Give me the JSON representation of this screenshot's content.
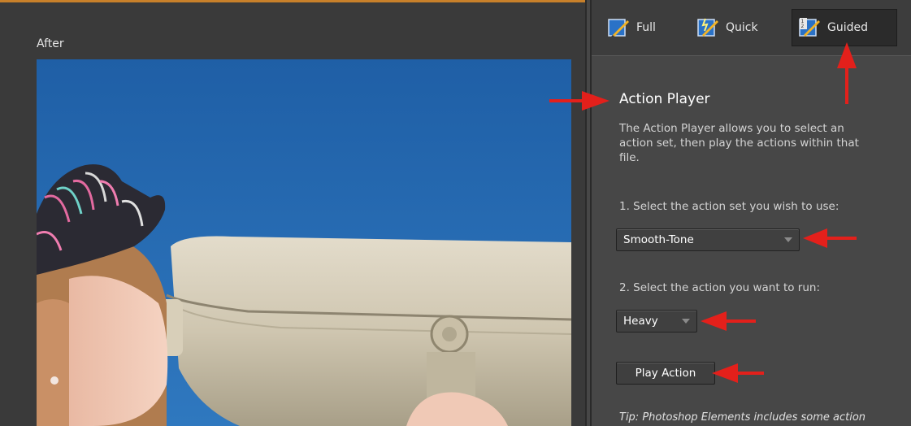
{
  "canvas": {
    "view_label": "After"
  },
  "tabs": [
    {
      "label": "Full",
      "icon": "full-edit-icon",
      "active": false
    },
    {
      "label": "Quick",
      "icon": "quick-edit-icon",
      "active": false
    },
    {
      "label": "Guided",
      "icon": "guided-edit-icon",
      "active": true
    }
  ],
  "panel": {
    "title": "Action Player",
    "description": "The Action Player allows you to select an action set, then play the actions within that file.",
    "step1_label": "1. Select the action set you wish to use:",
    "action_set_value": "Smooth-Tone",
    "step2_label": "2. Select the action you want to run:",
    "action_value": "Heavy",
    "play_button_label": "Play Action",
    "tip_text": "Tip: Photoshop Elements includes some action"
  },
  "colors": {
    "accent": "#c8802a",
    "annotation_arrow": "#e3201b",
    "panel_bg": "#474747",
    "canvas_bg": "#3a3a3a"
  }
}
